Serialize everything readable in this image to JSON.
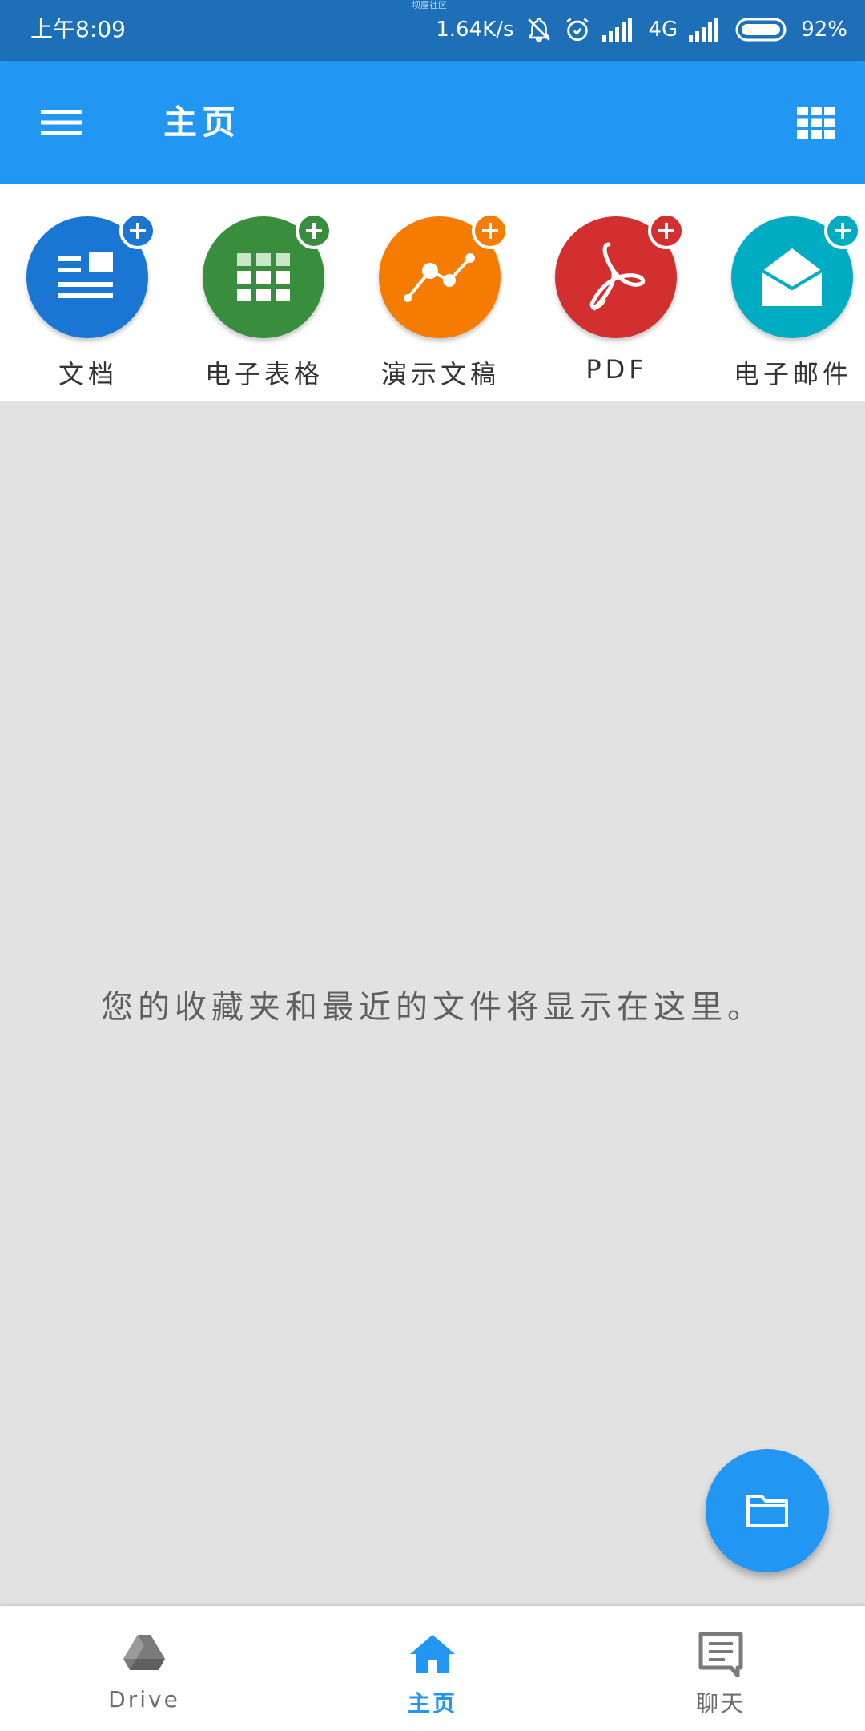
{
  "status_bar": {
    "time": "上午8:09",
    "watermark": "坝屋社区",
    "net_speed": "1.64K/s",
    "network": "4G",
    "battery": "92%",
    "icons": [
      "notifications-off-icon",
      "alarm-icon",
      "signal-icon",
      "signal-icon",
      "battery-icon"
    ]
  },
  "app_bar": {
    "title": "主页",
    "menu_icon": "hamburger-menu-icon",
    "grid_icon": "grid-view-icon"
  },
  "shortcuts": [
    {
      "label": "文档",
      "color": "#1976d2",
      "icon": "document-icon"
    },
    {
      "label": "电子表格",
      "color": "#388e3c",
      "icon": "spreadsheet-icon"
    },
    {
      "label": "演示文稿",
      "color": "#f57c00",
      "icon": "presentation-icon"
    },
    {
      "label": "PDF",
      "color": "#d32f2f",
      "icon": "pdf-icon"
    },
    {
      "label": "电子邮件",
      "color": "#00acc1",
      "icon": "email-icon"
    }
  ],
  "main": {
    "empty_message": "您的收藏夹和最近的文件将显示在这里。"
  },
  "fab": {
    "icon": "folder-icon",
    "color": "#2196f3"
  },
  "bottom_nav": [
    {
      "label": "Drive",
      "icon": "drive-icon",
      "active": false
    },
    {
      "label": "主页",
      "icon": "home-icon",
      "active": true
    },
    {
      "label": "聊天",
      "icon": "chat-icon",
      "active": false
    }
  ],
  "colors": {
    "accent": "#2196f3",
    "status_bar": "#1d6fb8",
    "inactive": "#6d6d6d"
  }
}
